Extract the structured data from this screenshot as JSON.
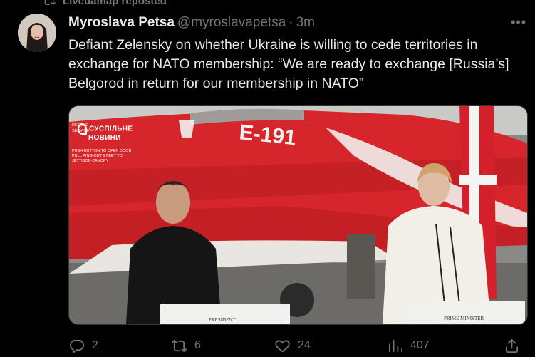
{
  "repost": {
    "label": "Liveuamap reposted",
    "icon": "repost-icon"
  },
  "author": {
    "name": "Myroslava Petsa",
    "handle": "@myroslavapetsa",
    "separator": "·",
    "time": "3m"
  },
  "tweet": {
    "text": "Defiant Zelensky on whether Ukraine is willing to cede territories in exchange for NATO membership: “We are ready to exchange [Russia’s] Belgorod in return for our membership in NATO”"
  },
  "media": {
    "watermark_line1": "СУСПІЛЬНЕ",
    "watermark_line2": "НОВИНИ",
    "jet_marking": "E-191",
    "podium_left": "PRESIDENT",
    "podium_right": "PRIME MINISTER",
    "jet_notice_1": "RESCUE",
    "jet_notice_2": "SERVICE",
    "jet_notice_3": "PUSH BUTTON TO OPEN DOOR",
    "jet_notice_4": "PULL RING OUT 6 FEET TO",
    "jet_notice_5": "JETTISON CANOPY"
  },
  "actions": {
    "replies": "2",
    "reposts": "6",
    "likes": "24",
    "views": "407"
  },
  "colors": {
    "background": "#000000",
    "text": "#e7e9ea",
    "muted": "#71767b",
    "jet_red": "#d7262b"
  }
}
